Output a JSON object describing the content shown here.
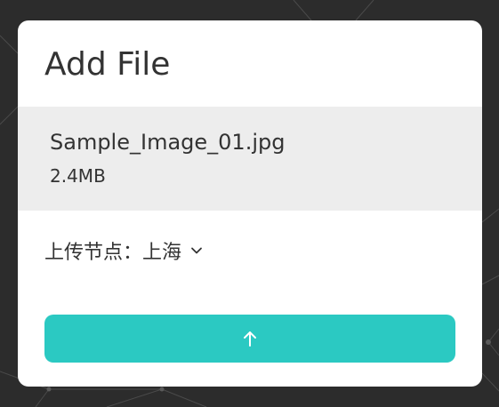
{
  "dialog": {
    "title": "Add File",
    "file": {
      "name": "Sample_Image_01.jpg",
      "size": "2.4MB"
    },
    "upload_node": {
      "label": "上传节点：",
      "value": "上海",
      "icon": "chevron-down-icon"
    },
    "upload_button": {
      "icon": "arrow-up-icon",
      "color": "#2bc9c2"
    }
  },
  "colors": {
    "background": "#2c2c2c",
    "card": "#ffffff",
    "file_panel": "#ededed",
    "text": "#333333",
    "accent": "#2bc9c2"
  }
}
